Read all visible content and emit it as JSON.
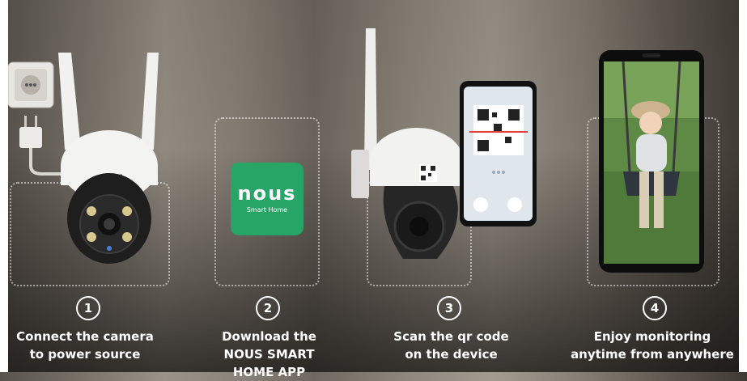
{
  "brand": {
    "camera_logo": "nous",
    "app_logo": "nous",
    "app_subtitle": "Smart Home",
    "app_color": "#26a566"
  },
  "steps": [
    {
      "number": "①",
      "lines": [
        "Connect the camera",
        "to power source"
      ]
    },
    {
      "number": "②",
      "lines": [
        "Download the",
        "NOUS SMART",
        "HOME APP"
      ]
    },
    {
      "number": "③",
      "lines": [
        "Scan the qr code",
        "on the device"
      ]
    },
    {
      "number": "④",
      "lines": [
        "Enjoy monitoring",
        "anytime from anywhere"
      ]
    }
  ],
  "icons": [
    "power-socket-icon",
    "power-plug-icon",
    "outdoor-camera-icon",
    "nous-app-icon",
    "ptz-camera-icon",
    "qr-code-icon",
    "smartphone-icon"
  ]
}
